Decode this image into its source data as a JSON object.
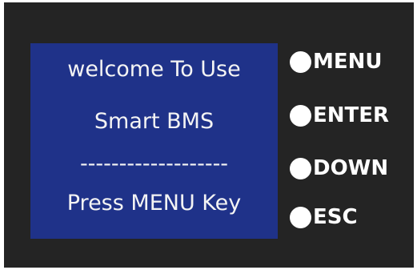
{
  "display": {
    "lines": [
      "welcome To Use",
      "Smart BMS",
      "-------------------",
      "Press MENU Key"
    ],
    "background_color": "#1f3289",
    "text_color": "#f4f4f4"
  },
  "buttons": [
    {
      "label": "MENU",
      "icon": "white-circle"
    },
    {
      "label": "ENTER",
      "icon": "white-circle"
    },
    {
      "label": "DOWN",
      "icon": "white-circle"
    },
    {
      "label": "ESC",
      "icon": "white-circle"
    }
  ],
  "panel": {
    "background_color": "#242424"
  }
}
